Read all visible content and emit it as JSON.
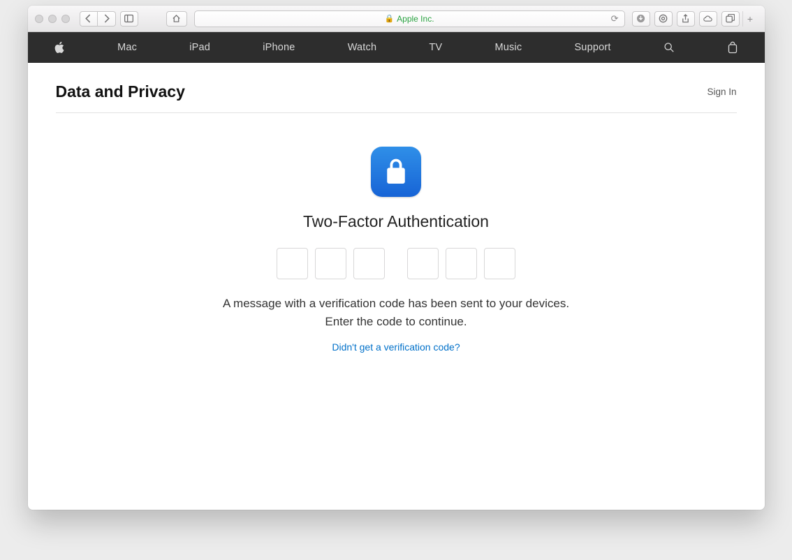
{
  "browser": {
    "url_label": "Apple Inc."
  },
  "nav": {
    "items": [
      "Mac",
      "iPad",
      "iPhone",
      "Watch",
      "TV",
      "Music",
      "Support"
    ]
  },
  "subheader": {
    "title": "Data and Privacy",
    "signin": "Sign In"
  },
  "twofa": {
    "title": "Two-Factor Authentication",
    "message": "A message with a verification code has been sent to your devices. Enter the code to continue.",
    "resend": "Didn't get a verification code?",
    "digits": [
      "",
      "",
      "",
      "",
      "",
      ""
    ]
  }
}
